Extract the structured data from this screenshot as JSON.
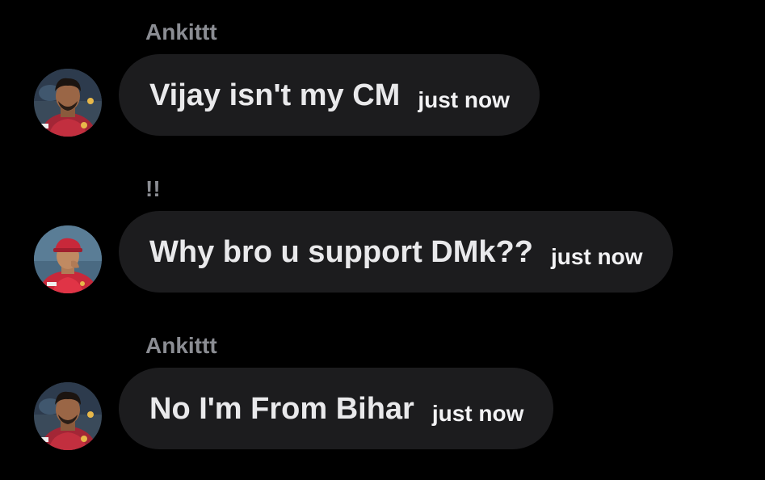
{
  "messages": [
    {
      "sender": "Ankittt",
      "text": "Vijay isn't my CM",
      "time": "just now",
      "avatar": "avatar-player-maroon-jersey"
    },
    {
      "sender": "!!",
      "text": "Why bro u support DMk??",
      "time": "just now",
      "avatar": "avatar-player-red-cap"
    },
    {
      "sender": "Ankittt",
      "text": "No I'm From Bihar",
      "time": "just now",
      "avatar": "avatar-player-maroon-jersey"
    }
  ],
  "colors": {
    "background": "#000000",
    "bubble": "#1c1c1e",
    "sender_name": "#8b8d93",
    "message_text": "#e9e9eb"
  }
}
